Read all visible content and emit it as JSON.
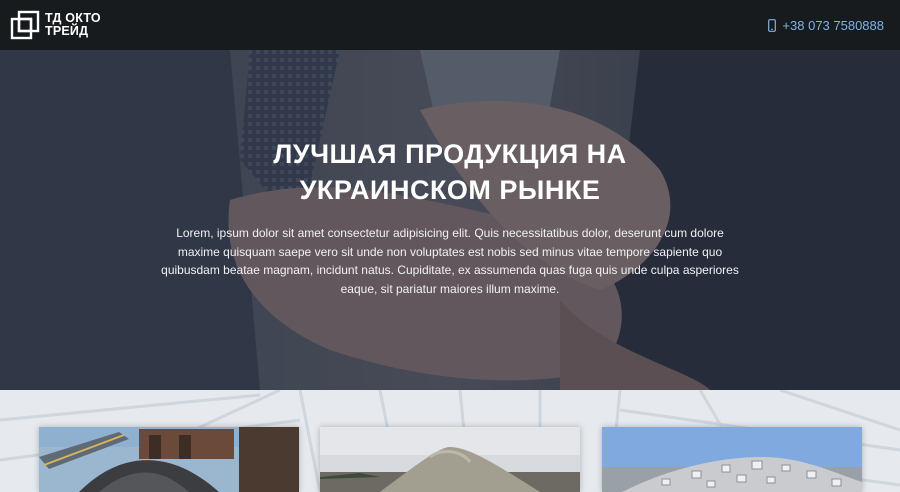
{
  "header": {
    "brand_line1": "ТД ОКТО",
    "brand_line2": "ТРЕЙД",
    "logo_icon": "brand-logo-icon",
    "phone": "+38 073 7580888",
    "phone_icon": "smartphone-icon"
  },
  "hero": {
    "title_line1": "ЛУЧШАЯ ПРОДУКЦИЯ НА",
    "title_line2": "УКРАИНСКОМ РЫНКЕ",
    "text": "Lorem, ipsum dolor sit amet consectetur adipisicing elit. Quis necessitatibus dolor, deserunt cum dolore maxime quisquam saepe vero sit unde non voluptates est nobis sed minus vitae tempore sapiente quo quibusdam beatae magnam, incidunt natus. Cupiditate, ex assumenda quas fuga quis unde culpa asperiores eaque, sit pariatur maiores illum maxime."
  },
  "products": {
    "items": [
      {
        "image": "coal-conveyor-photo"
      },
      {
        "image": "sand-pile-photo"
      },
      {
        "image": "crushed-stone-photo"
      }
    ]
  },
  "colors": {
    "header_bg": "#171b1e",
    "phone_accent": "#7fb2e5",
    "hero_overlay": "#1c2130"
  }
}
